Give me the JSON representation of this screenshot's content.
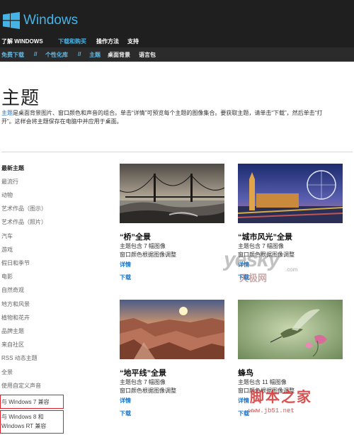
{
  "header": {
    "brand": "Windows",
    "nav": [
      "了解 WINDOWS",
      "下载和购买",
      "操作方法",
      "支持"
    ]
  },
  "subnav": {
    "items": [
      "免费下载",
      "//",
      "个性化库",
      "//",
      "主题",
      "桌面背景",
      "语言包"
    ]
  },
  "page": {
    "title": "主题",
    "desc_keyword": "主题",
    "desc_line1": "是桌面背景图片、窗口颜色和声音的组合。单击“详情”可预览每个主题的图像集合。要获取主题，请单击“下载”，然后单击“打",
    "desc_line2": "开”。这样会将主题保存在电脑中并应用于桌面。"
  },
  "sidebar": {
    "items": [
      "最新主题",
      "最流行",
      "动物",
      "艺术作品（图示）",
      "艺术作品（照片）",
      "汽车",
      "游戏",
      "假日和季节",
      "电影",
      "自然奇观",
      "地方和风景",
      "植物和花卉",
      "品牌主题",
      "来自社区",
      "RSS 动态主题",
      "全景",
      "使用自定义声音",
      "与 Windows 7 兼容",
      "与 Windows 8 和",
      "Windows RT 兼容"
    ]
  },
  "themes": [
    {
      "title": "“桥”全景",
      "count": "主题包含 7 幅图像",
      "note": "窗口颜色根据图像调整",
      "details": "详情",
      "download": "下载"
    },
    {
      "title": "“城市风光”全景",
      "count": "主题包含 7 幅图像",
      "note": "窗口颜色根据图像调整",
      "details": "详情",
      "download": "下载"
    },
    {
      "title": "“地平线”全景",
      "count": "主题包含 7 幅图像",
      "note": "窗口颜色根据图像调整",
      "details": "详情",
      "download": "下载"
    },
    {
      "title": "蜂鸟",
      "count": "主题包含 11 幅图像",
      "note": "窗口颜色根据图像调整",
      "details": "详情",
      "download": "下载"
    }
  ],
  "watermarks": {
    "yesky": "yesky",
    "yesky_cn": "天极网",
    "yesky_com": ".com",
    "jb51": "脚本之家",
    "jb51_url": "www.jb51.net"
  },
  "colors": {
    "header_bg": "#1f1f1f",
    "accent": "#46b3e6",
    "link": "#1a73c8",
    "highlight_box": "#d6222a"
  }
}
